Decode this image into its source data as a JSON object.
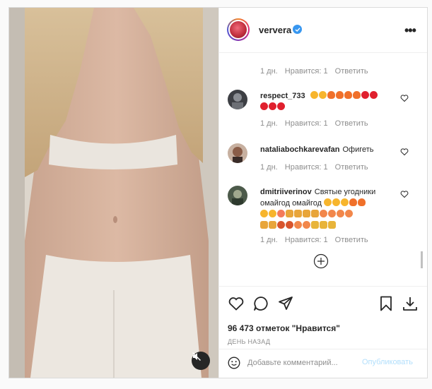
{
  "post": {
    "username": "ververa",
    "verified": true,
    "more_label": "•••"
  },
  "colors": {
    "accent": "#3897f0",
    "like": "#ed4956",
    "muted": "#8e8e8e",
    "post_disabled": "#b2dffc"
  },
  "top_meta": {
    "time": "1 дн.",
    "likes": "Нравится: 1",
    "reply": "Ответить"
  },
  "comments": [
    {
      "username": "respect_733",
      "text": "",
      "emoji_line": [
        "smile-hearts",
        "smile-hearts",
        "fire",
        "fire",
        "fire",
        "fire",
        "heart",
        "heart",
        "heart",
        "heart",
        "heart"
      ],
      "time": "1 дн.",
      "likes": "Нравится: 1",
      "reply": "Ответить"
    },
    {
      "username": "nataliabochkarevafan",
      "text": "Офигеть",
      "time": "1 дн.",
      "likes": "Нравится: 1",
      "reply": "Ответить"
    },
    {
      "username": "dmitriiverinov",
      "text": "Святые угодники омайгод омайгод",
      "emoji_line": [
        "smile",
        "smile",
        "smile",
        "fire",
        "fire",
        "smile",
        "smile",
        "smile",
        "thumbs-up",
        "thumbs-up",
        "thumbs-up",
        "thumbs-up",
        "peach",
        "peach",
        "peach",
        "peach",
        "thumbs-up",
        "thumbs-up",
        "peach",
        "peach",
        "peach",
        "peach",
        "pray",
        "pray",
        "pray"
      ],
      "time": "1 дн.",
      "likes": "Нравится: 1",
      "reply": "Ответить"
    }
  ],
  "actions": {
    "views": "96 473 отметок \"Нравится\"",
    "time": "ДЕНЬ НАЗАД"
  },
  "comment_box": {
    "placeholder": "Добавьте комментарий...",
    "post_label": "Опубликовать"
  }
}
